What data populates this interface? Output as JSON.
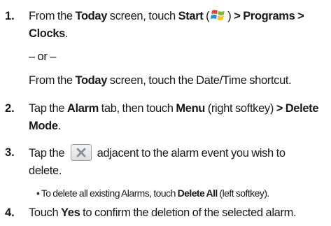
{
  "steps": [
    {
      "number": "1.",
      "line1_pre": "From the ",
      "line1_b1": "Today",
      "line1_mid": " screen, touch ",
      "line1_b2": "Start",
      "line1_paren_open": " (",
      "line1_paren_close": ") ",
      "line1_b3": "> Programs >",
      "line2_b1": "Clocks",
      "line2_post": ".",
      "or_text": "– or –",
      "alt_pre": "From the ",
      "alt_b1": "Today",
      "alt_post": " screen, touch the Date/Time shortcut."
    },
    {
      "number": "2.",
      "line1_pre": "Tap the ",
      "line1_b1": "Alarm",
      "line1_mid": " tab, then touch ",
      "line1_b2": "Menu",
      "line1_mid2": " (right softkey) ",
      "line1_b3": "> Delete",
      "line2_b1": "Mode",
      "line2_post": "."
    },
    {
      "number": "3.",
      "line1_pre": "Tap the ",
      "line1_post": " adjacent to the alarm event you wish to",
      "line2": "delete.",
      "bullet_pre": "• To delete all existing Alarms, touch ",
      "bullet_b": "Delete All",
      "bullet_post": " (left softkey)."
    },
    {
      "number": "4.",
      "line1_pre": "Touch ",
      "line1_b1": "Yes",
      "line1_post": " to confirm the deletion of the selected alarm."
    }
  ],
  "icons": {
    "start": "windows-start-logo-icon",
    "delete": "delete-x-button-icon"
  },
  "colors": {
    "text": "#1a1a1a",
    "logo_red": "#e8452c",
    "logo_green": "#7cbb2a",
    "logo_blue": "#1e8fd6",
    "logo_yellow": "#f6c21a",
    "x_mark": "#8a9096"
  }
}
